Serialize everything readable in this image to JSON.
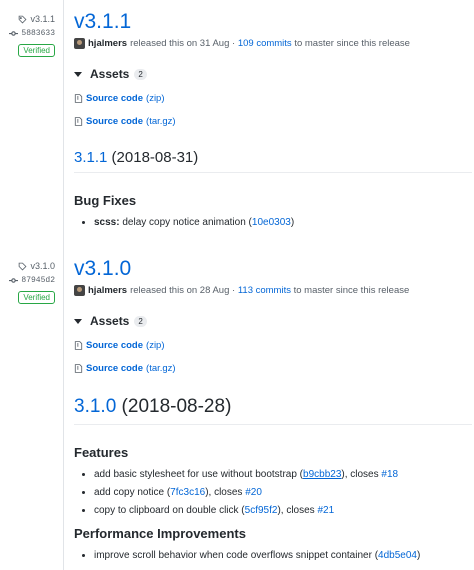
{
  "releases": [
    {
      "tag": "v3.1.1",
      "commit": "5883633",
      "verified": "Verified",
      "title": "v3.1.1",
      "author": "hjalmers",
      "released_text": "released this on 31 Aug ·",
      "commits_link": "109 commits",
      "commits_suffix": "to master since this release",
      "assets_label": "Assets",
      "assets_count": "2",
      "assets": [
        {
          "label": "Source code",
          "type": "(zip)"
        },
        {
          "label": "Source code",
          "type": "(tar.gz)"
        }
      ],
      "version_link": "3.1.1",
      "version_date": "(2018-08-31)",
      "sections": [
        {
          "title": "Bug Fixes",
          "items": [
            {
              "bold": "scss:",
              "text": "delay copy notice animation (",
              "hash": "10e0303",
              "tail": ")"
            }
          ]
        }
      ]
    },
    {
      "tag": "v3.1.0",
      "commit": "87945d2",
      "verified": "Verified",
      "title": "v3.1.0",
      "author": "hjalmers",
      "released_text": "released this on 28 Aug ·",
      "commits_link": "113 commits",
      "commits_suffix": "to master since this release",
      "assets_label": "Assets",
      "assets_count": "2",
      "assets": [
        {
          "label": "Source code",
          "type": "(zip)"
        },
        {
          "label": "Source code",
          "type": "(tar.gz)"
        }
      ],
      "version_link": "3.1.0",
      "version_date": "(2018-08-28)",
      "sections": [
        {
          "title": "Features",
          "items": [
            {
              "text": "add basic stylesheet for use without bootstrap (",
              "hash": "b9cbb23",
              "mid": "), closes ",
              "issue": "#18"
            },
            {
              "text": "add copy notice (",
              "hash": "7fc3c16",
              "mid": "), closes ",
              "issue": "#20"
            },
            {
              "text": "copy to clipboard on double click (",
              "hash": "5cf95f2",
              "mid": "), closes ",
              "issue": "#21"
            }
          ]
        },
        {
          "title": "Performance Improvements",
          "items": [
            {
              "text": "improve scroll behavior when code overflows snippet container (",
              "hash": "4db5e04",
              "tail": ")"
            }
          ]
        }
      ]
    }
  ]
}
